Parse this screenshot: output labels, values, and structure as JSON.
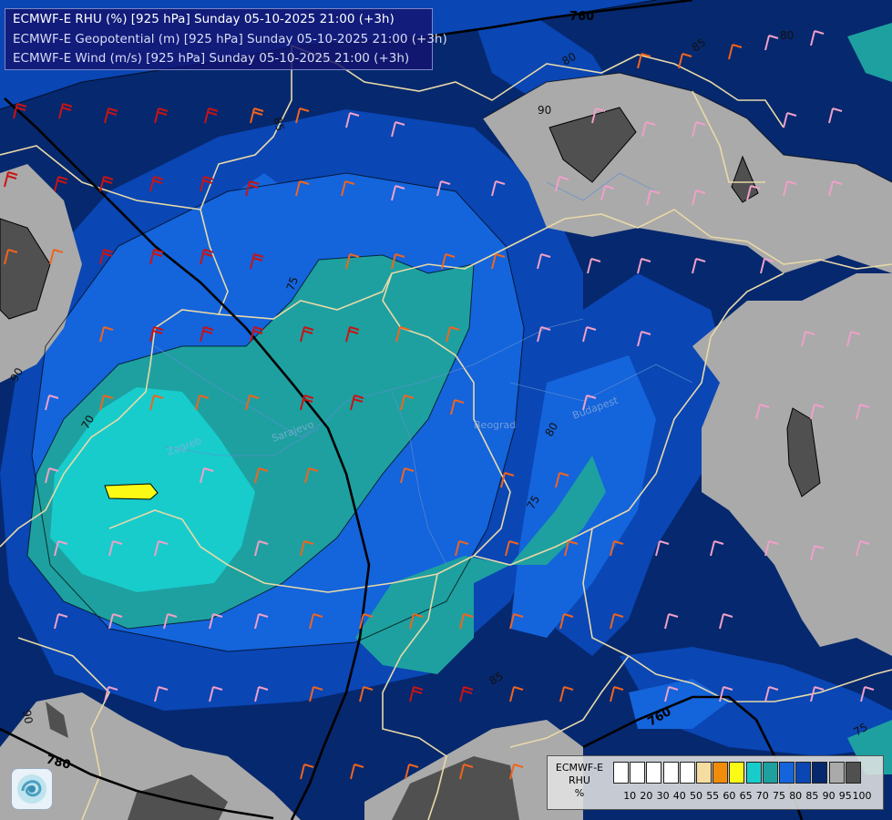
{
  "title": {
    "line1": "ECMWF-E RHU (%) [925 hPa] Sunday 05-10-2025 21:00 (+3h)",
    "line2": "ECMWF-E Geopotential (m) [925 hPa] Sunday 05-10-2025 21:00 (+3h)",
    "line3": "ECMWF-E Wind (m/s) [925 hPa] Sunday 05-10-2025 21:00 (+3h)"
  },
  "legend": {
    "title_line1": "ECMWF-E",
    "title_line2": "RHU",
    "unit": "%",
    "ticks": [
      "10",
      "20",
      "30",
      "40",
      "50",
      "55",
      "60",
      "65",
      "70",
      "75",
      "80",
      "85",
      "90",
      "95",
      "100"
    ],
    "colors": [
      "#ffffff",
      "#ffffff",
      "#ffffff",
      "#ffffff",
      "#ffffff",
      "#f5dca0",
      "#f08c0a",
      "#fafa14",
      "#18cccc",
      "#1ea0a0",
      "#1464dc",
      "#0a46b4",
      "#06286e",
      "#aaaaaa",
      "#505050"
    ]
  },
  "geopotential_labels": [
    "760",
    "780",
    "760"
  ],
  "rhu_labels": [
    "85",
    "80",
    "90",
    "85",
    "75",
    "70",
    "90",
    "80",
    "75",
    "85",
    "90",
    "80",
    "75"
  ],
  "place_labels": [
    "Beograd",
    "Zagreb",
    "Sarajevo",
    "Budapest"
  ],
  "icons": {
    "logo": "ecmwf-swirl-logo"
  }
}
